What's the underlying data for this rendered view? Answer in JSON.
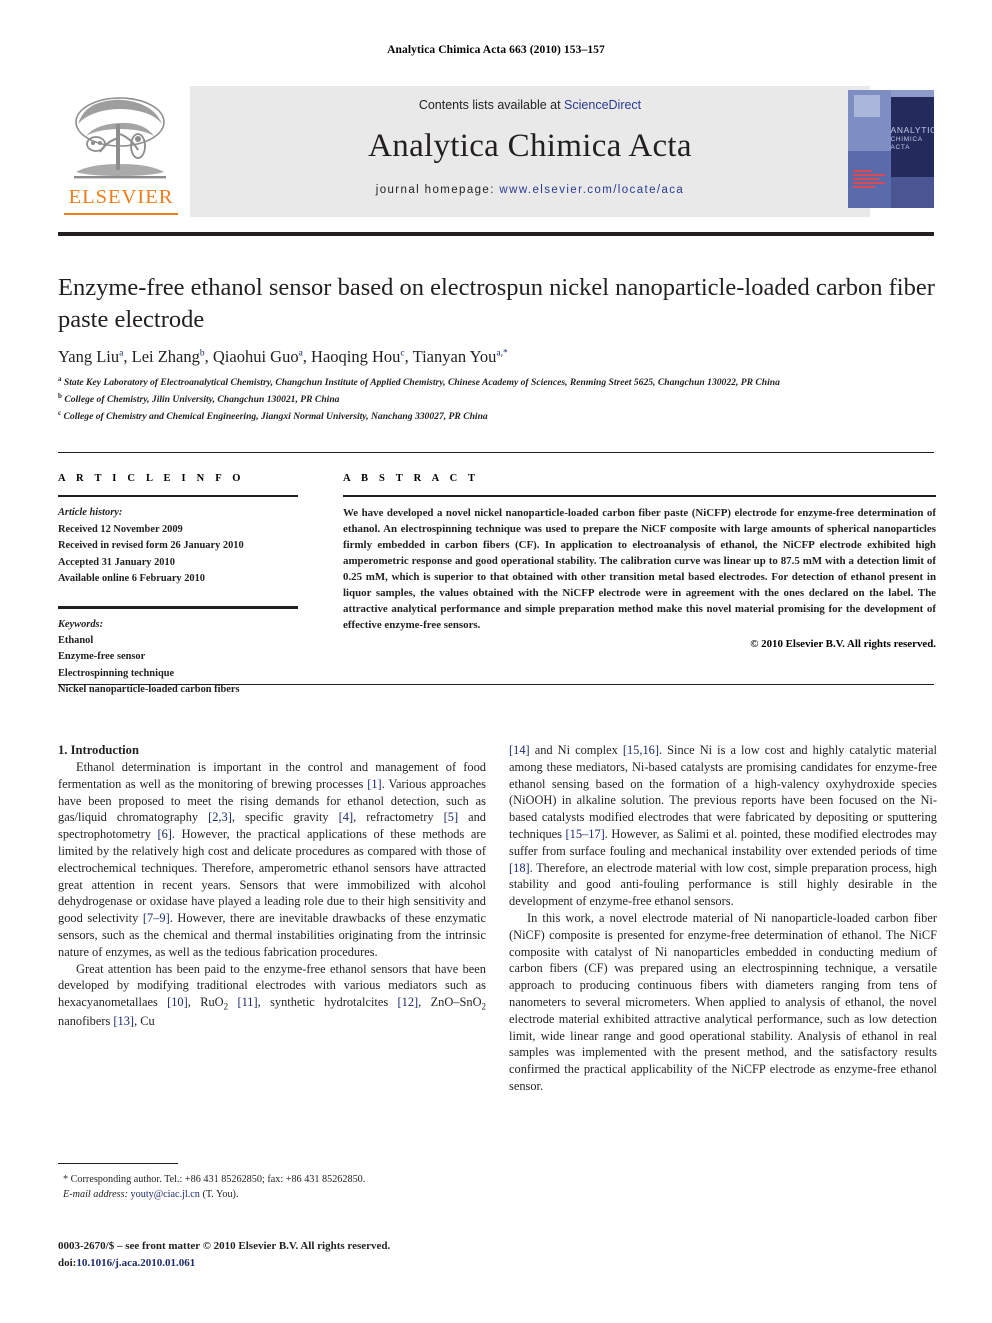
{
  "running_head": "Analytica Chimica Acta 663 (2010) 153–157",
  "masthead": {
    "contents_prefix": "Contents lists available at ",
    "sciencedirect": "ScienceDirect",
    "journal_title": "Analytica Chimica Acta",
    "homepage_prefix": "journal homepage: ",
    "homepage_url": "www.elsevier.com/locate/aca",
    "publisher_logo_text": "ELSEVIER",
    "cover_title": "ANALYTICA",
    "cover_subtitle": "CHIMICA ACTA",
    "accent_orange": "#f07c1a",
    "link_blue": "#2a3b8f"
  },
  "article": {
    "title": "Enzyme-free ethanol sensor based on electrospun nickel nanoparticle-loaded carbon fiber paste electrode",
    "authors": [
      {
        "name": "Yang Liu",
        "marks": "a"
      },
      {
        "name": "Lei Zhang",
        "marks": "b"
      },
      {
        "name": "Qiaohui Guo",
        "marks": "a"
      },
      {
        "name": "Haoqing Hou",
        "marks": "c"
      },
      {
        "name": "Tianyan You",
        "marks": "a,*"
      }
    ],
    "affiliations": [
      {
        "mark": "a",
        "text": "State Key Laboratory of Electroanalytical Chemistry, Changchun Institute of Applied Chemistry, Chinese Academy of Sciences, Renming Street 5625, Changchun 130022, PR China"
      },
      {
        "mark": "b",
        "text": "College of Chemistry, Jilin University, Changchun 130021, PR China"
      },
      {
        "mark": "c",
        "text": "College of Chemistry and Chemical Engineering, Jiangxi Normal University, Nanchang 330027, PR China"
      }
    ]
  },
  "article_info": {
    "heading": "A R T I C L E    I N F O",
    "history_label": "Article history:",
    "history": [
      "Received 12 November 2009",
      "Received in revised form 26 January 2010",
      "Accepted 31 January 2010",
      "Available online 6 February 2010"
    ],
    "keywords_label": "Keywords:",
    "keywords": [
      "Ethanol",
      "Enzyme-free sensor",
      "Electrospinning technique",
      "Nickel nanoparticle-loaded carbon fibers"
    ]
  },
  "abstract": {
    "heading": "A B S T R A C T",
    "text": "We have developed a novel nickel nanoparticle-loaded carbon fiber paste (NiCFP) electrode for enzyme-free determination of ethanol. An electrospinning technique was used to prepare the NiCF composite with large amounts of spherical nanoparticles firmly embedded in carbon fibers (CF). In application to electroanalysis of ethanol, the NiCFP electrode exhibited high amperometric response and good operational stability. The calibration curve was linear up to 87.5 mM with a detection limit of 0.25 mM, which is superior to that obtained with other transition metal based electrodes. For detection of ethanol present in liquor samples, the values obtained with the NiCFP electrode were in agreement with the ones declared on the label. The attractive analytical performance and simple preparation method make this novel material promising for the development of effective enzyme-free sensors.",
    "copyright": "© 2010 Elsevier B.V. All rights reserved."
  },
  "body": {
    "section_number_title": "1.  Introduction",
    "left_paragraphs": [
      "Ethanol determination is important in the control and management of food fermentation as well as the monitoring of brewing processes [1]. Various approaches have been proposed to meet the rising demands for ethanol detection, such as gas/liquid chromatography [2,3], specific gravity [4], refractometry [5] and spectrophotometry [6]. However, the practical applications of these methods are limited by the relatively high cost and delicate procedures as compared with those of electrochemical techniques. Therefore, amperometric ethanol sensors have attracted great attention in recent years. Sensors that were immobilized with alcohol dehydrogenase or oxidase have played a leading role due to their high sensitivity and good selectivity [7–9]. However, there are inevitable drawbacks of these enzymatic sensors, such as the chemical and thermal instabilities originating from the intrinsic nature of enzymes, as well as the tedious fabrication procedures.",
      "Great attention has been paid to the enzyme-free ethanol sensors that have been developed by modifying traditional electrodes with various mediators such as hexacyanometallaes [10], RuO2 [11], synthetic hydrotalcites [12], ZnO–SnO2 nanofibers [13], Cu"
    ],
    "right_paragraphs": [
      "[14] and Ni complex [15,16]. Since Ni is a low cost and highly catalytic material among these mediators, Ni-based catalysts are promising candidates for enzyme-free ethanol sensing based on the formation of a high-valency oxyhydroxide species (NiOOH) in alkaline solution. The previous reports have been focused on the Ni-based catalysts modified electrodes that were fabricated by depositing or sputtering techniques [15–17]. However, as Salimi et al. pointed, these modified electrodes may suffer from surface fouling and mechanical instability over extended periods of time [18]. Therefore, an electrode material with low cost, simple preparation process, high stability and good anti-fouling performance is still highly desirable in the development of enzyme-free ethanol sensors.",
      "In this work, a novel electrode material of Ni nanoparticle-loaded carbon fiber (NiCF) composite is presented for enzyme-free determination of ethanol. The NiCF composite with catalyst of Ni nanoparticles embedded in conducting medium of carbon fibers (CF) was prepared using an electrospinning technique, a versatile approach to producing continuous fibers with diameters ranging from tens of nanometers to several micrometers. When applied to analysis of ethanol, the novel electrode material exhibited attractive analytical performance, such as low detection limit, wide linear range and good operational stability. Analysis of ethanol in real samples was implemented with the present method, and the satisfactory results confirmed the practical applicability of the NiCFP electrode as enzyme-free ethanol sensor."
    ]
  },
  "footnote": {
    "corresponding": "* Corresponding author. Tel.: +86 431 85262850; fax: +86 431 85262850.",
    "email_label": "E-mail address:",
    "email": "youty@ciac.jl.cn",
    "email_owner": "(T. You)."
  },
  "imprint": {
    "issn_line": "0003-2670/$ – see front matter © 2010 Elsevier B.V. All rights reserved.",
    "doi_label": "doi:",
    "doi": "10.1016/j.aca.2010.01.061"
  }
}
